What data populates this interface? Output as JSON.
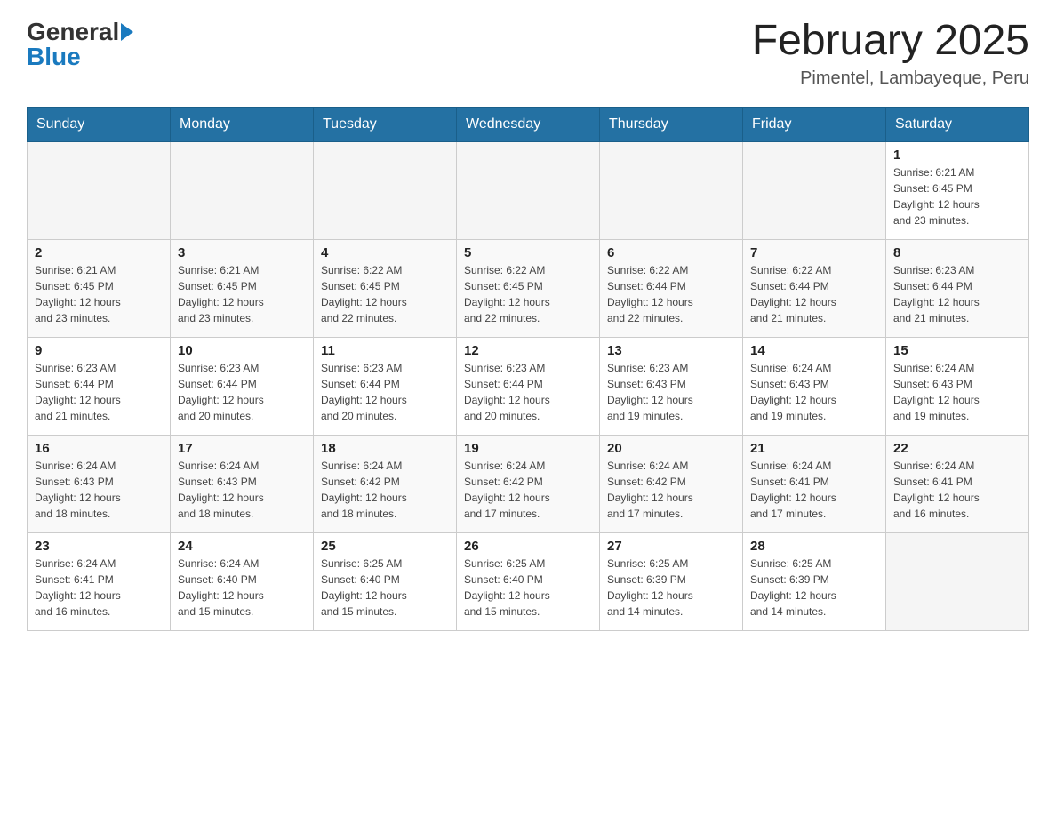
{
  "header": {
    "logo_general": "General",
    "logo_blue": "Blue",
    "month_title": "February 2025",
    "location": "Pimentel, Lambayeque, Peru"
  },
  "days_of_week": [
    "Sunday",
    "Monday",
    "Tuesday",
    "Wednesday",
    "Thursday",
    "Friday",
    "Saturday"
  ],
  "weeks": [
    [
      {
        "day": "",
        "info": ""
      },
      {
        "day": "",
        "info": ""
      },
      {
        "day": "",
        "info": ""
      },
      {
        "day": "",
        "info": ""
      },
      {
        "day": "",
        "info": ""
      },
      {
        "day": "",
        "info": ""
      },
      {
        "day": "1",
        "info": "Sunrise: 6:21 AM\nSunset: 6:45 PM\nDaylight: 12 hours\nand 23 minutes."
      }
    ],
    [
      {
        "day": "2",
        "info": "Sunrise: 6:21 AM\nSunset: 6:45 PM\nDaylight: 12 hours\nand 23 minutes."
      },
      {
        "day": "3",
        "info": "Sunrise: 6:21 AM\nSunset: 6:45 PM\nDaylight: 12 hours\nand 23 minutes."
      },
      {
        "day": "4",
        "info": "Sunrise: 6:22 AM\nSunset: 6:45 PM\nDaylight: 12 hours\nand 22 minutes."
      },
      {
        "day": "5",
        "info": "Sunrise: 6:22 AM\nSunset: 6:45 PM\nDaylight: 12 hours\nand 22 minutes."
      },
      {
        "day": "6",
        "info": "Sunrise: 6:22 AM\nSunset: 6:44 PM\nDaylight: 12 hours\nand 22 minutes."
      },
      {
        "day": "7",
        "info": "Sunrise: 6:22 AM\nSunset: 6:44 PM\nDaylight: 12 hours\nand 21 minutes."
      },
      {
        "day": "8",
        "info": "Sunrise: 6:23 AM\nSunset: 6:44 PM\nDaylight: 12 hours\nand 21 minutes."
      }
    ],
    [
      {
        "day": "9",
        "info": "Sunrise: 6:23 AM\nSunset: 6:44 PM\nDaylight: 12 hours\nand 21 minutes."
      },
      {
        "day": "10",
        "info": "Sunrise: 6:23 AM\nSunset: 6:44 PM\nDaylight: 12 hours\nand 20 minutes."
      },
      {
        "day": "11",
        "info": "Sunrise: 6:23 AM\nSunset: 6:44 PM\nDaylight: 12 hours\nand 20 minutes."
      },
      {
        "day": "12",
        "info": "Sunrise: 6:23 AM\nSunset: 6:44 PM\nDaylight: 12 hours\nand 20 minutes."
      },
      {
        "day": "13",
        "info": "Sunrise: 6:23 AM\nSunset: 6:43 PM\nDaylight: 12 hours\nand 19 minutes."
      },
      {
        "day": "14",
        "info": "Sunrise: 6:24 AM\nSunset: 6:43 PM\nDaylight: 12 hours\nand 19 minutes."
      },
      {
        "day": "15",
        "info": "Sunrise: 6:24 AM\nSunset: 6:43 PM\nDaylight: 12 hours\nand 19 minutes."
      }
    ],
    [
      {
        "day": "16",
        "info": "Sunrise: 6:24 AM\nSunset: 6:43 PM\nDaylight: 12 hours\nand 18 minutes."
      },
      {
        "day": "17",
        "info": "Sunrise: 6:24 AM\nSunset: 6:43 PM\nDaylight: 12 hours\nand 18 minutes."
      },
      {
        "day": "18",
        "info": "Sunrise: 6:24 AM\nSunset: 6:42 PM\nDaylight: 12 hours\nand 18 minutes."
      },
      {
        "day": "19",
        "info": "Sunrise: 6:24 AM\nSunset: 6:42 PM\nDaylight: 12 hours\nand 17 minutes."
      },
      {
        "day": "20",
        "info": "Sunrise: 6:24 AM\nSunset: 6:42 PM\nDaylight: 12 hours\nand 17 minutes."
      },
      {
        "day": "21",
        "info": "Sunrise: 6:24 AM\nSunset: 6:41 PM\nDaylight: 12 hours\nand 17 minutes."
      },
      {
        "day": "22",
        "info": "Sunrise: 6:24 AM\nSunset: 6:41 PM\nDaylight: 12 hours\nand 16 minutes."
      }
    ],
    [
      {
        "day": "23",
        "info": "Sunrise: 6:24 AM\nSunset: 6:41 PM\nDaylight: 12 hours\nand 16 minutes."
      },
      {
        "day": "24",
        "info": "Sunrise: 6:24 AM\nSunset: 6:40 PM\nDaylight: 12 hours\nand 15 minutes."
      },
      {
        "day": "25",
        "info": "Sunrise: 6:25 AM\nSunset: 6:40 PM\nDaylight: 12 hours\nand 15 minutes."
      },
      {
        "day": "26",
        "info": "Sunrise: 6:25 AM\nSunset: 6:40 PM\nDaylight: 12 hours\nand 15 minutes."
      },
      {
        "day": "27",
        "info": "Sunrise: 6:25 AM\nSunset: 6:39 PM\nDaylight: 12 hours\nand 14 minutes."
      },
      {
        "day": "28",
        "info": "Sunrise: 6:25 AM\nSunset: 6:39 PM\nDaylight: 12 hours\nand 14 minutes."
      },
      {
        "day": "",
        "info": ""
      }
    ]
  ]
}
